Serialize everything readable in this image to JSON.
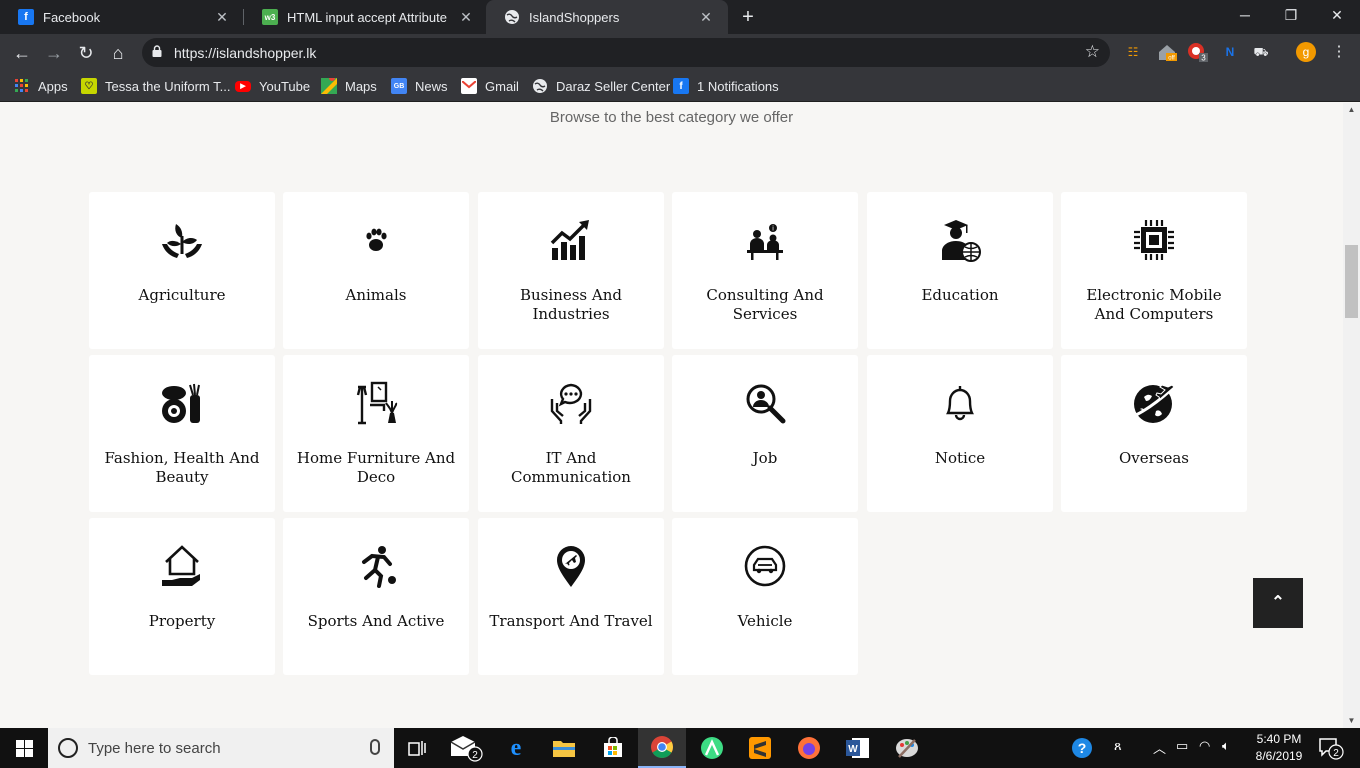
{
  "browser": {
    "tabs": [
      {
        "title": "Facebook",
        "favicon": "facebook-icon",
        "favicon_color": "#1877f2"
      },
      {
        "title": "HTML input accept Attribute",
        "favicon": "w3schools-icon",
        "favicon_color": "#4caf50"
      },
      {
        "title": "IslandShoppers",
        "favicon": "globe-icon",
        "favicon_color": "#e8eaed"
      }
    ],
    "new_tab_label": "+",
    "url": "https://islandshopper.lk",
    "bookmarks": [
      {
        "label": "Apps",
        "icon": "apps-grid-icon"
      },
      {
        "label": "Tessa the Uniform T...",
        "icon": "tessa-icon"
      },
      {
        "label": "YouTube",
        "icon": "youtube-icon"
      },
      {
        "label": "Maps",
        "icon": "maps-icon"
      },
      {
        "label": "News",
        "icon": "news-icon"
      },
      {
        "label": "Gmail",
        "icon": "gmail-icon"
      },
      {
        "label": "Daraz Seller Center",
        "icon": "globe-icon"
      },
      {
        "label": "1 Notifications",
        "icon": "facebook-icon"
      }
    ],
    "extensions": {
      "off_badge": "off",
      "count_badge": "3",
      "profile_initial": "g"
    }
  },
  "page": {
    "subtitle": "Browse to the best category we offer",
    "categories": [
      {
        "label": "Agriculture",
        "icon": "plant-hands-icon"
      },
      {
        "label": "Animals",
        "icon": "paw-icon"
      },
      {
        "label": "Business And Industries",
        "icon": "growth-chart-icon"
      },
      {
        "label": "Consulting And Services",
        "icon": "consulting-icon"
      },
      {
        "label": "Education",
        "icon": "graduate-icon"
      },
      {
        "label": "Electronic Mobile And Computers",
        "icon": "chip-icon"
      },
      {
        "label": "Fashion, Health And Beauty",
        "icon": "cosmetics-icon"
      },
      {
        "label": "Home Furniture And Deco",
        "icon": "furniture-icon"
      },
      {
        "label": "IT And Communication",
        "icon": "chat-hands-icon"
      },
      {
        "label": "Job",
        "icon": "job-search-icon"
      },
      {
        "label": "Notice",
        "icon": "bell-icon"
      },
      {
        "label": "Overseas",
        "icon": "plane-globe-icon"
      },
      {
        "label": "Property",
        "icon": "house-hand-icon"
      },
      {
        "label": "Sports And Active",
        "icon": "soccer-player-icon"
      },
      {
        "label": "Transport And Travel",
        "icon": "location-plane-icon"
      },
      {
        "label": "Vehicle",
        "icon": "car-circle-icon"
      }
    ],
    "scroll_top_label": "⌃"
  },
  "taskbar": {
    "search_placeholder": "Type here to search",
    "mail_badge": "2",
    "time": "5:40 PM",
    "date": "8/6/2019",
    "notification_count": "2"
  }
}
